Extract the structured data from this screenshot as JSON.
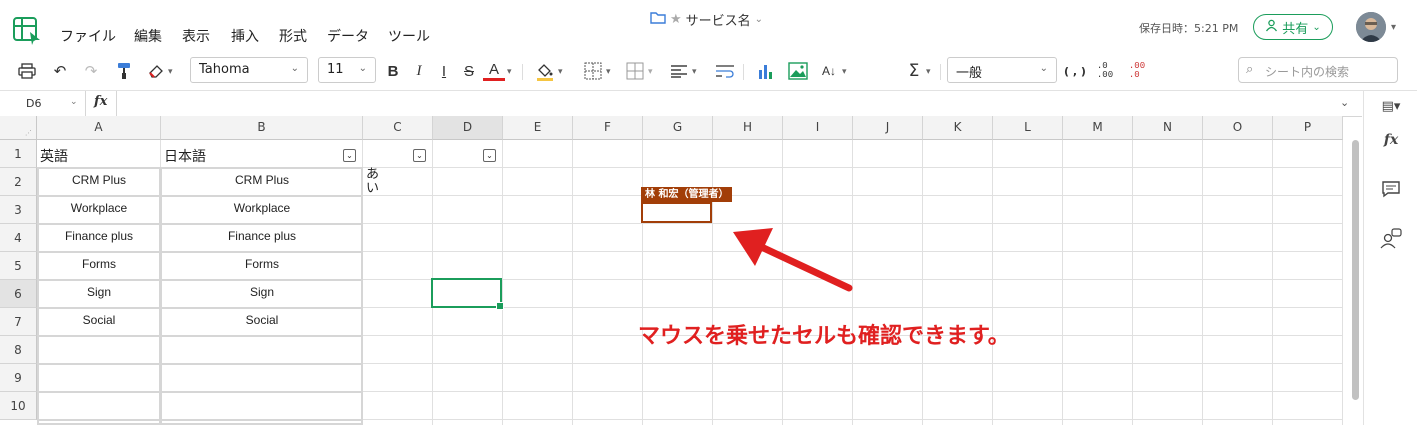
{
  "menu": [
    "ファイル",
    "編集",
    "表示",
    "挿入",
    "形式",
    "データ",
    "ツール"
  ],
  "doc_title": "サービス名",
  "saved_status": "保存日時：5:21 PM",
  "share_label": "共有",
  "toolbar": {
    "font_name": "Tahoma",
    "font_size": "11",
    "number_format": "一般",
    "search_placeholder": "シート内の検索",
    "bold": "B",
    "italic": "I",
    "strike": "S",
    "font_color": "A"
  },
  "formula_bar": {
    "name_box": "D6",
    "fx": "fx"
  },
  "columns": [
    "A",
    "B",
    "C",
    "D",
    "E",
    "F",
    "G",
    "H",
    "I",
    "J",
    "K",
    "L",
    "M",
    "N",
    "O",
    "P"
  ],
  "rows": [
    "1",
    "2",
    "3",
    "4",
    "5",
    "6",
    "7",
    "8",
    "9",
    "10"
  ],
  "table": {
    "headers": [
      "英語",
      "日本語"
    ],
    "col_a": [
      "CRM Plus",
      "Workplace",
      "Finance plus",
      "Forms",
      "Sign",
      "Social"
    ],
    "col_b": [
      "CRM Plus",
      "Workplace",
      "Finance plus",
      "Forms",
      "Sign",
      "Social"
    ],
    "c2_text": "あい"
  },
  "collab_user": "林 和宏（管理者）",
  "annotation": "マウスを乗せたセルも確認できます。",
  "colors": {
    "accent": "#1b9d5b",
    "collab": "#a23e08",
    "annotation": "#e02020"
  }
}
